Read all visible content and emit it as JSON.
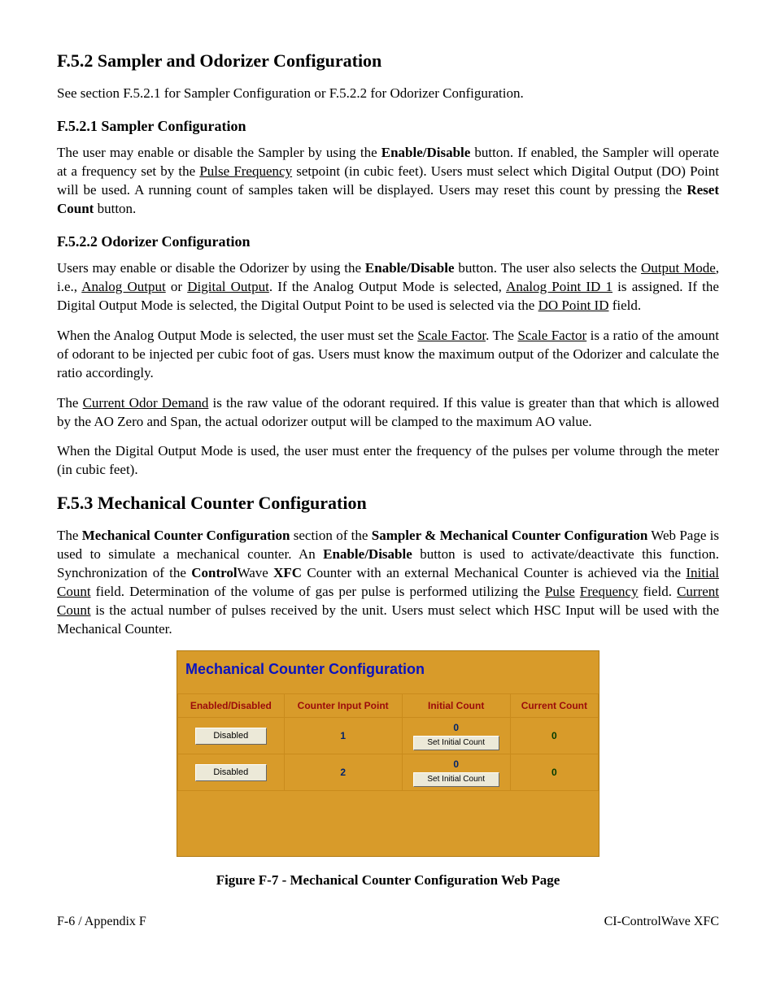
{
  "h_f52": "F.5.2  Sampler and Odorizer Configuration",
  "p_f52_intro": "See section F.5.2.1 for Sampler Configuration or F.5.2.2 for Odorizer Configuration.",
  "h_f521": "F.5.2.1  Sampler Configuration",
  "p_f521_a1": "The user may enable or disable the Sampler by using the ",
  "p_f521_a2": "Enable/Disable",
  "p_f521_a3": " button. If enabled, the Sampler will operate at a frequency set by the ",
  "p_f521_a4": "Pulse Frequency",
  "p_f521_a5": " setpoint (in cubic feet). Users must select which Digital Output (DO) Point will be used. A running count of samples taken will be displayed. Users may reset this count by pressing the ",
  "p_f521_a6": "Reset Count",
  "p_f521_a7": " button.",
  "h_f522": "F.5.2.2  Odorizer Configuration",
  "p_f522_a1": "Users may enable or disable the Odorizer by using the ",
  "p_f522_a2": "Enable/Disable",
  "p_f522_a3": " button. The user also selects the ",
  "p_f522_a4": "Output Mode",
  "p_f522_a5": ", i.e., ",
  "p_f522_a6": "Analog Output",
  "p_f522_a7": " or ",
  "p_f522_a8": "Digital Output",
  "p_f522_a9": ". If the Analog Output Mode is selected, ",
  "p_f522_a10": "Analog Point ID 1",
  "p_f522_a11": " is assigned. If the Digital Output Mode is selected, the Digital Output Point to be used is selected via the ",
  "p_f522_a12": "DO Point ID",
  "p_f522_a13": " field.",
  "p_f522_b1": "When the Analog Output Mode is selected, the user must set the ",
  "p_f522_b2": "Scale Factor",
  "p_f522_b3": ". The ",
  "p_f522_b4": "Scale Factor",
  "p_f522_b5": " is a ratio of the amount of odorant to be injected per cubic foot of gas. Users must know the maximum output of the Odorizer and calculate the ratio accordingly.",
  "p_f522_c1": "The ",
  "p_f522_c2": "Current Odor Demand",
  "p_f522_c3": " is the raw value of the odorant required. If this value is greater than that which is allowed by the AO Zero and Span, the actual odorizer output will be clamped to the maximum AO value.",
  "p_f522_d": "When the Digital Output Mode is used, the user must enter the frequency of the pulses per volume through the meter (in cubic feet).",
  "h_f53": "F.5.3  Mechanical Counter Configuration",
  "p_f53_a1": "The ",
  "p_f53_a2": "Mechanical Counter Configuration",
  "p_f53_a3": " section of the ",
  "p_f53_a4": "Sampler & Mechanical Counter Configuration",
  "p_f53_a5": " Web Page is used to simulate a mechanical counter. An ",
  "p_f53_a6": "Enable/Disable",
  "p_f53_a7": " button is used to activate/deactivate this function. Synchronization of the ",
  "p_f53_a8": "Control",
  "p_f53_a9": "Wave ",
  "p_f53_a10": "XFC",
  "p_f53_a11": " Counter with an external Mechanical Counter is achieved via the ",
  "p_f53_a12": "Initial Count",
  "p_f53_a13": " field. Determination of the volume of gas per pulse is performed utilizing the ",
  "p_f53_a14": "Pulse",
  "p_f53_a15": " ",
  "p_f53_a16": "Frequency",
  "p_f53_a17": " field. ",
  "p_f53_a18": "Current Count",
  "p_f53_a19": " is the actual number of pulses received by the unit. Users must select which HSC Input will be used with the Mechanical Counter.",
  "panel": {
    "title": "Mechanical Counter Configuration",
    "headers": {
      "enabled": "Enabled/Disabled",
      "cip": "Counter Input Point",
      "initial": "Initial Count",
      "current": "Current Count"
    },
    "rows": [
      {
        "state": "Disabled",
        "cip": "1",
        "initial": "0",
        "set_label": "Set Initial Count",
        "current": "0"
      },
      {
        "state": "Disabled",
        "cip": "2",
        "initial": "0",
        "set_label": "Set Initial Count",
        "current": "0"
      }
    ]
  },
  "figure_caption": "Figure F-7 - Mechanical Counter Configuration Web Page",
  "footer_left": "F-6 / Appendix F",
  "footer_right": "CI-ControlWave XFC"
}
